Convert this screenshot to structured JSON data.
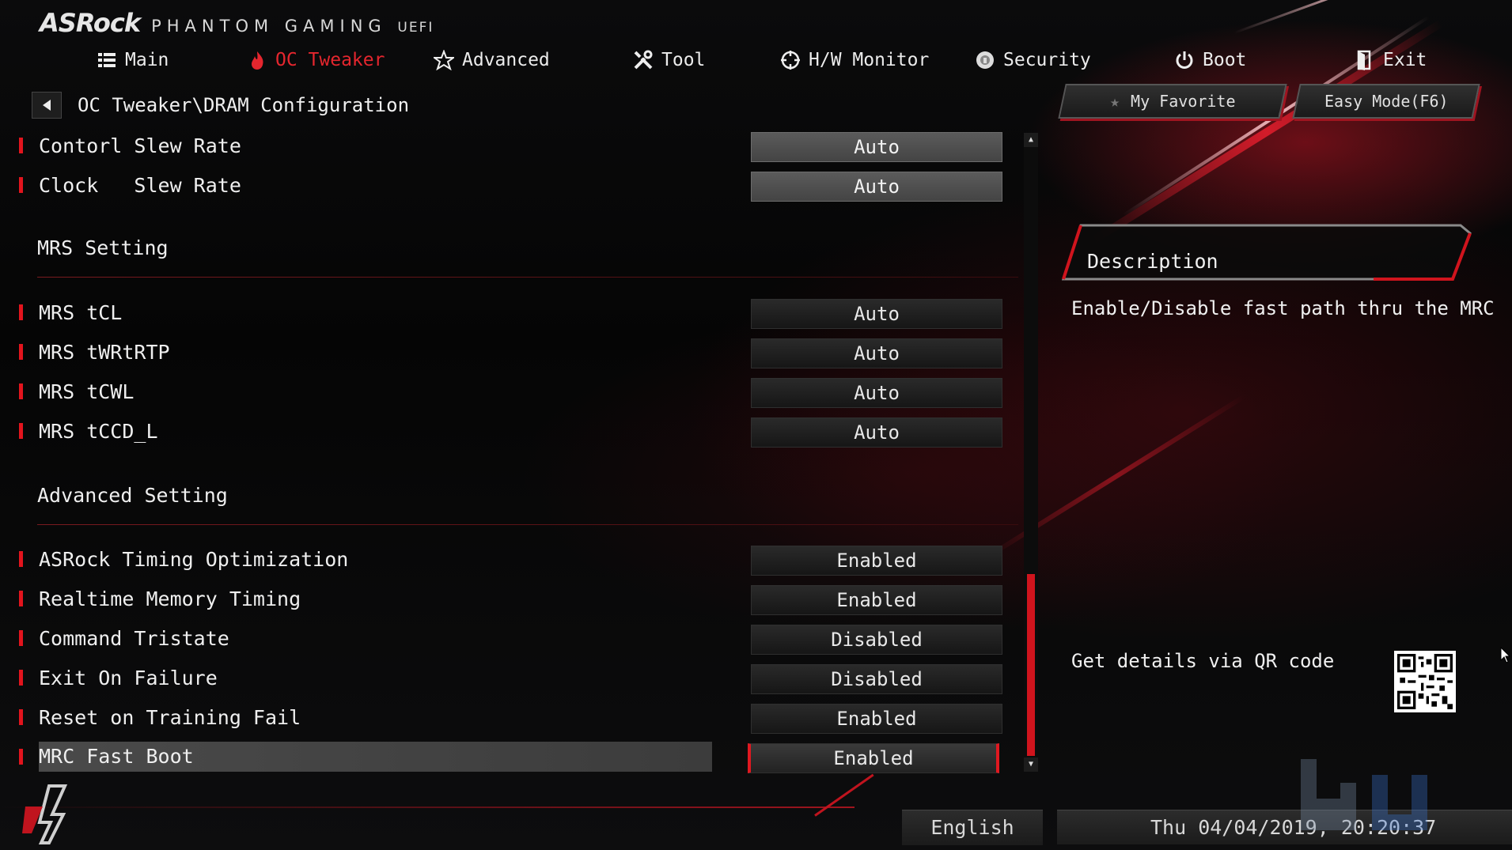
{
  "brand": {
    "logo": "ASRock",
    "subtitle": "PHANTOM GAMING",
    "uefi": "UEFI"
  },
  "nav": [
    {
      "label": "Main",
      "icon": "list-icon"
    },
    {
      "label": "OC Tweaker",
      "icon": "flame-icon"
    },
    {
      "label": "Advanced",
      "icon": "star-icon"
    },
    {
      "label": "Tool",
      "icon": "tools-icon"
    },
    {
      "label": "H/W Monitor",
      "icon": "crosshair-icon"
    },
    {
      "label": "Security",
      "icon": "shield-icon"
    },
    {
      "label": "Boot",
      "icon": "power-icon"
    },
    {
      "label": "Exit",
      "icon": "exit-door-icon"
    }
  ],
  "breadcrumb": "OC Tweaker\\DRAM Configuration",
  "buttons": {
    "favorite": "My Favorite",
    "easy_mode": "Easy Mode(F6)"
  },
  "rows_top": [
    {
      "label": "Contorl Slew Rate",
      "value": "Auto"
    },
    {
      "label": "Clock   Slew Rate",
      "value": "Auto"
    }
  ],
  "sections": {
    "mrs": "MRS Setting",
    "advanced": "Advanced Setting"
  },
  "rows_mrs": [
    {
      "label": "MRS tCL",
      "value": "Auto"
    },
    {
      "label": "MRS tWRtRTP",
      "value": "Auto"
    },
    {
      "label": "MRS tCWL",
      "value": "Auto"
    },
    {
      "label": "MRS tCCD_L",
      "value": "Auto"
    }
  ],
  "rows_adv": [
    {
      "label": "ASRock Timing Optimization",
      "value": "Enabled"
    },
    {
      "label": "Realtime Memory Timing",
      "value": "Enabled"
    },
    {
      "label": "Command Tristate",
      "value": "Disabled"
    },
    {
      "label": "Exit On Failure",
      "value": "Disabled"
    },
    {
      "label": "Reset on Training Fail",
      "value": "Enabled"
    },
    {
      "label": "MRC Fast Boot",
      "value": "Enabled"
    }
  ],
  "scroll": {
    "thumb_start": 0.7,
    "thumb_end": 1.0
  },
  "description": {
    "title": "Description",
    "text": "Enable/Disable fast path thru the MRC",
    "qr_text": "Get details via QR code"
  },
  "footer": {
    "language": "English",
    "datetime": "Thu 04/04/2019, 20:20:37"
  },
  "colors": {
    "accent": "#e2141d",
    "active_tab": "#e5262e",
    "bg": "#050505"
  }
}
